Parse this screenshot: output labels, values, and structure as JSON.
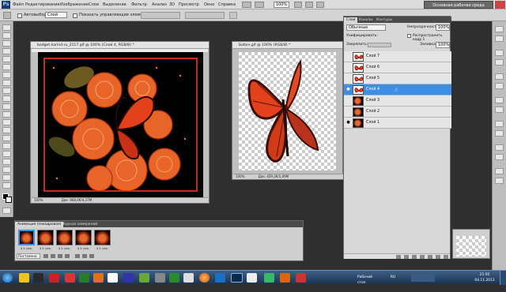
{
  "menubar": {
    "logo": "Ps",
    "items": [
      "Файл",
      "Редактирование",
      "Изображение",
      "Слои",
      "Выделение",
      "Фильтр",
      "Анализ",
      "3D",
      "Просмотр",
      "Окно",
      "Справка"
    ],
    "zoom": "100%",
    "workspace": "Основная рабочая среда"
  },
  "options": {
    "autoselect": "Автовыбор:",
    "autoselect_value": "Слой",
    "show_controls": "Показать управляющие элементы"
  },
  "doc1": {
    "title": "bodget.karind.ru_2117.gif @ 100% (Слой 4, RGB/8) *",
    "zoom": "100%",
    "status": "Док: 668,0K/4,27M"
  },
  "doc2": {
    "title": "Бабоч.gif @ 100% (RGB/8) *",
    "zoom": "100%",
    "status": "Док: 429,2K/1,09M"
  },
  "layers": {
    "tabs": [
      "Слои",
      "Каналы",
      "Контуры"
    ],
    "blend": "Обычные",
    "opacity_label": "Непрозрачность:",
    "opacity": "100%",
    "unify_label": "Унифицировать:",
    "propagate": "Распространить кадр 1",
    "lock_label": "Закрепить:",
    "fill_label": "Заливка:",
    "fill": "100%",
    "items": [
      {
        "name": "Слой 7",
        "visible": false,
        "thumb": "bfly",
        "selected": false
      },
      {
        "name": "Слой 6",
        "visible": false,
        "thumb": "bfly",
        "selected": false
      },
      {
        "name": "Слой 5",
        "visible": false,
        "thumb": "bfly",
        "selected": false
      },
      {
        "name": "Слой 4",
        "visible": true,
        "thumb": "bfly",
        "selected": true
      },
      {
        "name": "Слой 3",
        "visible": false,
        "thumb": "rose",
        "selected": false
      },
      {
        "name": "Слой 2",
        "visible": false,
        "thumb": "rose",
        "selected": false
      },
      {
        "name": "Слой 1",
        "visible": true,
        "thumb": "rose",
        "selected": false
      }
    ]
  },
  "animation": {
    "tabs": [
      "Анимация (покадровая)",
      "Журнал измерений"
    ],
    "frames": [
      {
        "num": "1",
        "time": "0,1 сек."
      },
      {
        "num": "2",
        "time": "0,1 сек."
      },
      {
        "num": "3",
        "time": "0,1 сек."
      },
      {
        "num": "4",
        "time": "0,1 сек."
      },
      {
        "num": "5",
        "time": "0,1 сек."
      }
    ],
    "loop": "Постоянно"
  },
  "taskbar": {
    "lang": "RU",
    "desk": "Рабочий стол",
    "time": "21:05",
    "date": "04.11.2013"
  },
  "colors": {
    "accent": "#3d8ee4",
    "frame_red": "#b8321c",
    "butterfly_orange": "#e2411c"
  }
}
